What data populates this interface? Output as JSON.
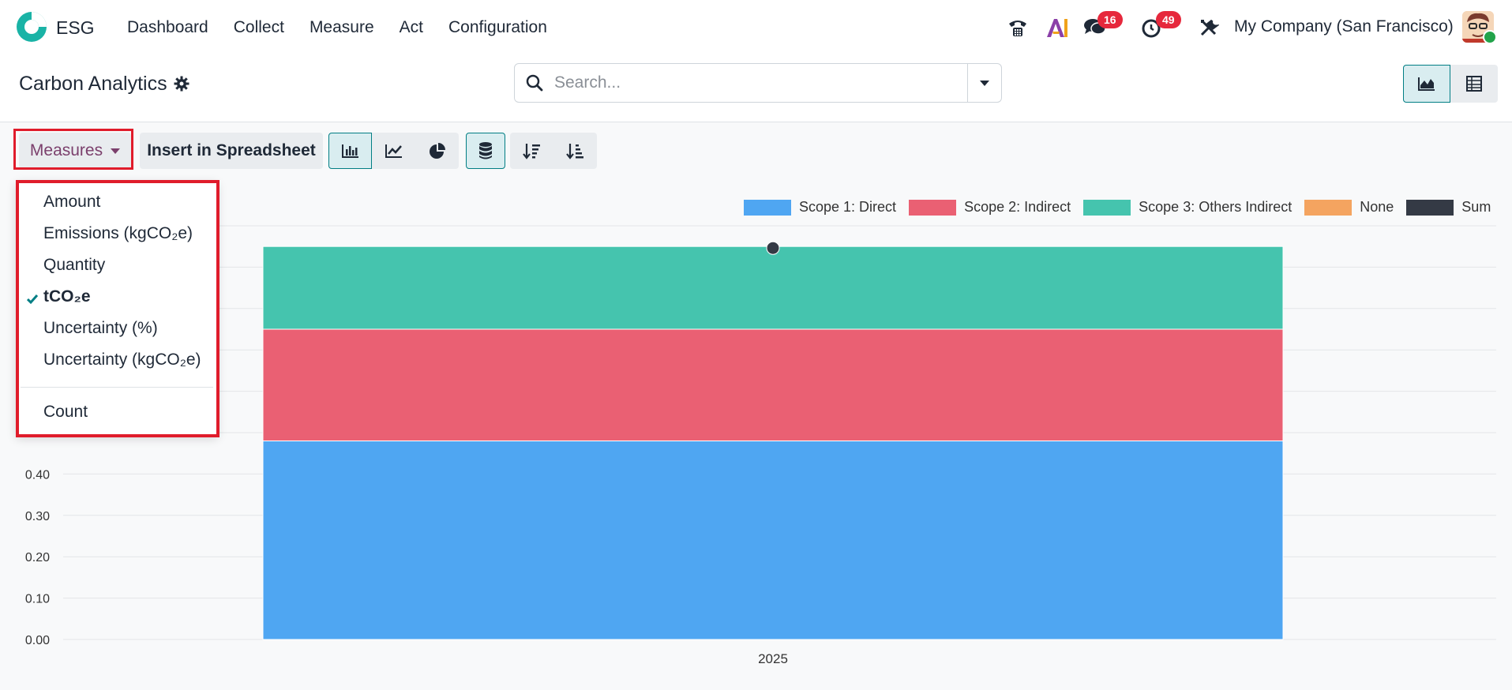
{
  "app": {
    "name": "ESG",
    "menu": [
      "Dashboard",
      "Collect",
      "Measure",
      "Act",
      "Configuration"
    ],
    "company": "My Company (San Francisco)",
    "badges": {
      "messages": "16",
      "activities": "49"
    },
    "icons": [
      "phone-icon",
      "ai-icon",
      "chat-icon",
      "clock-icon",
      "tools-icon"
    ]
  },
  "page": {
    "title": "Carbon Analytics"
  },
  "search": {
    "placeholder": "Search..."
  },
  "toolbar": {
    "measures_label": "Measures",
    "insert_label": "Insert in Spreadsheet"
  },
  "measures_menu": {
    "items": [
      "Amount",
      "Emissions (kgCO₂e)",
      "Quantity",
      "tCO₂e",
      "Uncertainty (%)",
      "Uncertainty (kgCO₂e)"
    ],
    "selected": "tCO₂e",
    "count_label": "Count"
  },
  "colors": {
    "accent": "#017e84",
    "highlight": "#e01c2b",
    "scope1": "#4fa6f2",
    "scope2": "#ea6073",
    "scope3": "#45c4ae",
    "none": "#f4a460",
    "sum": "#343a45"
  },
  "chart_data": {
    "type": "bar",
    "stacked": true,
    "categories": [
      "2025"
    ],
    "series": [
      {
        "name": "Scope 1: Direct",
        "values": [
          0.48
        ],
        "color": "#4fa6f2"
      },
      {
        "name": "Scope 2: Indirect",
        "values": [
          0.27
        ],
        "color": "#ea6073"
      },
      {
        "name": "Scope 3: Others Indirect",
        "values": [
          0.2
        ],
        "color": "#45c4ae"
      },
      {
        "name": "None",
        "values": [
          0
        ],
        "color": "#f4a460"
      },
      {
        "name": "Sum",
        "values": [
          0.95
        ],
        "color": "#343a45"
      }
    ],
    "y_ticks": [
      "0.00",
      "0.10",
      "0.20",
      "0.30",
      "0.40"
    ],
    "ylim": [
      0,
      1.0
    ],
    "grid": true,
    "legend_position": "top-right"
  }
}
